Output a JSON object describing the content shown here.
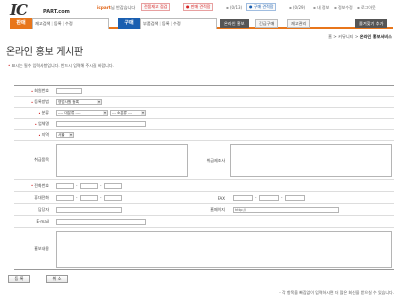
{
  "header": {
    "logo_main": "IC",
    "logo_sub": "PART.com",
    "welcome_user": "icpart",
    "welcome_text": "님 반갑습니다",
    "btn_stock_check": "전품재고 점검",
    "btn_sell_trade": "판매 견적함",
    "sell_count": "(0/13)",
    "btn_buy_trade": "구매 견적함",
    "buy_count": "(0/29)",
    "util_mypage": "내 정보",
    "util_account": "정보수정",
    "util_logout": "로그아웃"
  },
  "nav": {
    "sell_badge": "판매",
    "sell_items": [
      "재고검색",
      "등록",
      "수정"
    ],
    "buy_badge": "구매",
    "buy_items": [
      "부품검색",
      "등록",
      "수정"
    ],
    "tabs": [
      "온라인 홍보",
      "긴급구매",
      "재고관리"
    ],
    "tab_bookmark": "즐겨찾기 추가"
  },
  "breadcrumb": {
    "home": "홈",
    "community": "커뮤니티",
    "current": "온라인 홍보서비스"
  },
  "page": {
    "title": "온라인 홍보 게시판",
    "notice": "표시는 필수 입력사항입니다. 반드시 입력해 주시길 바랍니다."
  },
  "form": {
    "labels": {
      "member_no": "회원번호",
      "reg_type": "등록방법",
      "category": "분류",
      "company": "업체명",
      "region": "지역",
      "main_items": "취급품목",
      "maker": "취급제조사",
      "phone": "전화번호",
      "mobile": "휴대전화",
      "fax": "FAX",
      "contact": "담당자",
      "homepage": "홈페이지",
      "email": "E-mail",
      "promo": "홍보내용"
    },
    "reg_type_value": "영업사원 등록",
    "category_major": "---- 대분류 ----",
    "category_minor": "--- 소분류 ---",
    "region_value": "서울",
    "homepage_prefix": "http://"
  },
  "buttons": {
    "register": "등 록",
    "reset": "취 소"
  },
  "footer_note": "- 각 항목을 빠짐없이 입력하시면 더 많은 회신을 받으실 수 있습니다."
}
